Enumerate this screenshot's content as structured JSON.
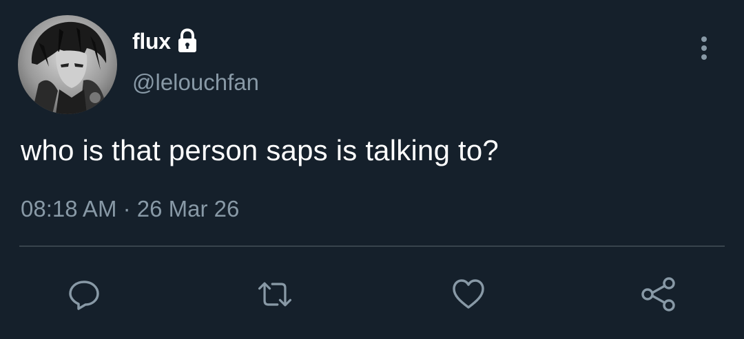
{
  "tweet": {
    "author": {
      "display_name": "flux",
      "handle": "@lelouchfan",
      "protected": true
    },
    "text": "who is that person saps is talking to?",
    "timestamp": "08:18 AM · 26 Mar 26"
  },
  "icons": {
    "lock": "lock-icon",
    "more": "more-vertical-icon",
    "reply": "reply-icon",
    "retweet": "retweet-icon",
    "like": "heart-icon",
    "share": "share-icon"
  },
  "colors": {
    "background": "#15202b",
    "secondary_text": "#8899a6",
    "divider": "#38444d",
    "primary_text": "#ffffff"
  }
}
